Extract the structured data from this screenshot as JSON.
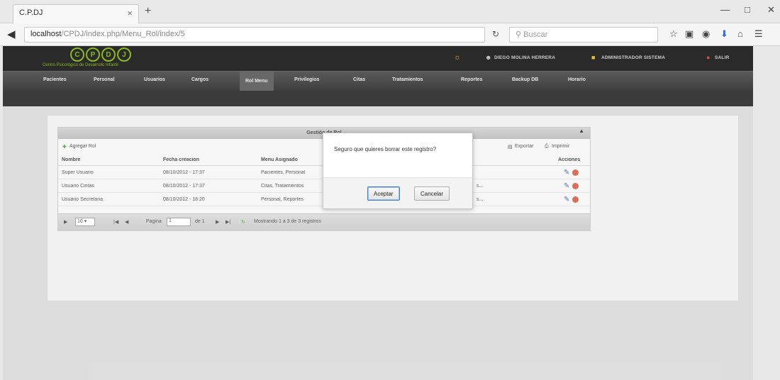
{
  "browser": {
    "tab_title": "C.P.DJ",
    "tab_close": "×",
    "new_tab": "+",
    "url_host": "localhost",
    "url_path": "/CPDJ/index.php/Menu_Rol/index/5",
    "search_placeholder": "Buscar",
    "window_controls": [
      "—",
      "□",
      "✕"
    ]
  },
  "app": {
    "logo_letters": [
      "C",
      "P",
      "D",
      "J"
    ],
    "logo_subtitle": "Centro Psicológico de Desarrollo Infantil",
    "header_user": "DIEGO MOLINA HERRERA",
    "header_admin": "ADMINISTRADOR SISTEMA",
    "header_logout": "SALIR",
    "menu": [
      "Pacientes",
      "Personal",
      "Usuarios",
      "Cargos",
      "Rol Menu",
      "Privilegios",
      "Citas",
      "Tratamientos",
      "Reportes",
      "Backup DB",
      "Horario"
    ],
    "active_menu": "Rol Menu"
  },
  "grid": {
    "title": "Gestión de Rol",
    "add_label": "Agregar Rol",
    "export_label": "Exportar",
    "print_label": "Imprimir",
    "columns": [
      "Nombre",
      "Fecha creacion",
      "Menu Asignado",
      "Acciones"
    ],
    "rows": [
      {
        "nombre": "Super Usuario",
        "fecha": "08/10/2012 - 17:37",
        "menu": "Pacientes, Personal",
        "menu_tail": ""
      },
      {
        "nombre": "Usuario Cintas",
        "fecha": "08/10/2012 - 17:37",
        "menu": "Citas, Tratamientos",
        "menu_tail": "s..."
      },
      {
        "nombre": "Usuario Secretaria",
        "fecha": "08/10/2012 - 18:20",
        "menu": "Personal, Reportes",
        "menu_tail": "s..."
      }
    ],
    "pager": {
      "page_size": "10",
      "page_label": "Pagina",
      "page_value": "1",
      "of_label": "de 1",
      "status": "Mostrando 1 a 3 de 3 registros"
    }
  },
  "dialog": {
    "message": "Seguro que quieres borrar este registro?",
    "confirm": "Aceptar",
    "cancel": "Cancelar"
  },
  "colors": {
    "accent_green": "#8ab820",
    "header_dark": "#2a2a2a",
    "menu_gray": "#4a4a4a"
  }
}
